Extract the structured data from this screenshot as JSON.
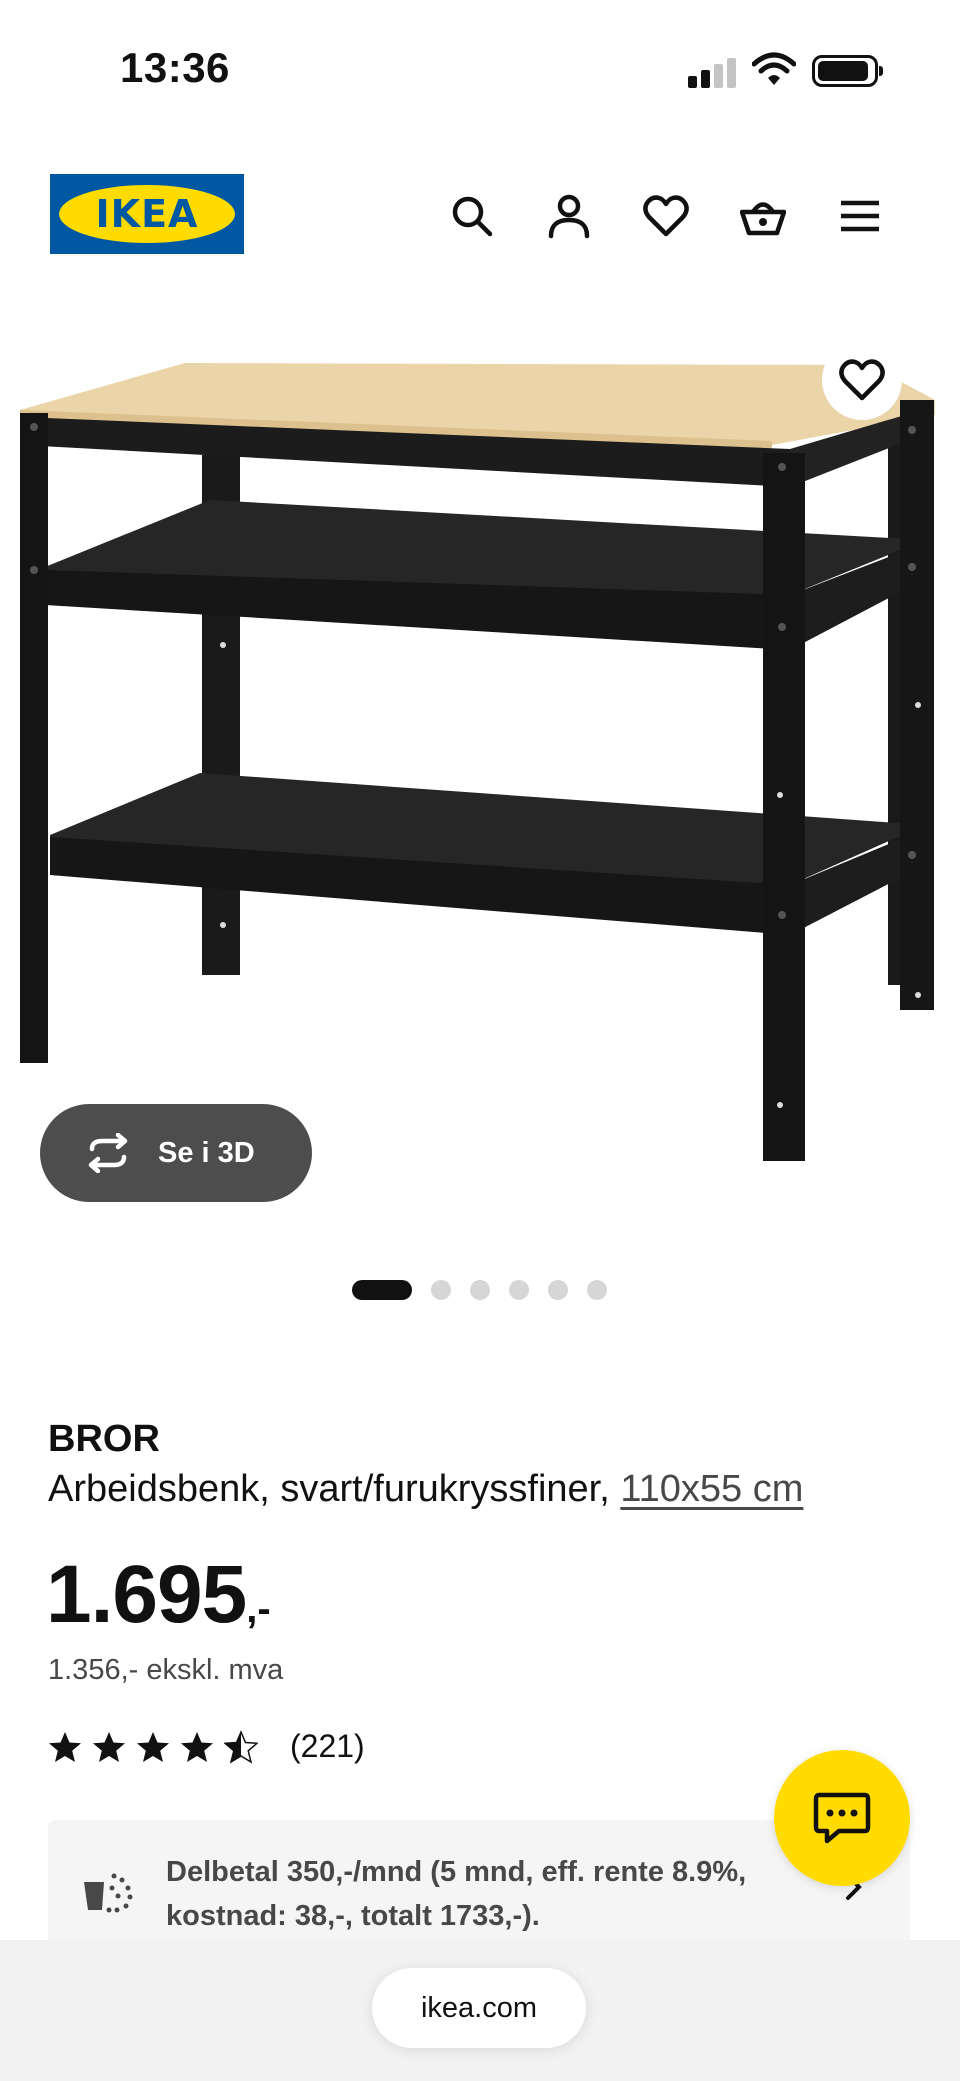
{
  "status_bar": {
    "time": "13:36"
  },
  "header": {
    "logo_text": "IKEA",
    "icons": [
      "search-icon",
      "account-icon",
      "wishlist-icon",
      "basket-icon",
      "menu-icon"
    ]
  },
  "gallery": {
    "view_3d_label": "Se i 3D",
    "slide_count": 6,
    "active_slide": 1
  },
  "product": {
    "name": "BROR",
    "description": "Arbeidsbenk, svart/furukryssfiner, ",
    "size": "110x55 cm",
    "price_main": "1.695",
    "price_suffix": ",-",
    "price_ex_vat": "1.356,- ekskl. mva",
    "rating": 4.5,
    "rating_count": "(221)"
  },
  "financing": {
    "text": "Delbetal 350,-/mnd (5 mnd, eff. rente 8.9%, kostnad: 38,-, totalt 1733,-)."
  },
  "browser": {
    "url": "ikea.com"
  },
  "colors": {
    "ikea_blue": "#0058a3",
    "ikea_yellow": "#ffdb00",
    "chip_grey": "#4d4d4d"
  }
}
